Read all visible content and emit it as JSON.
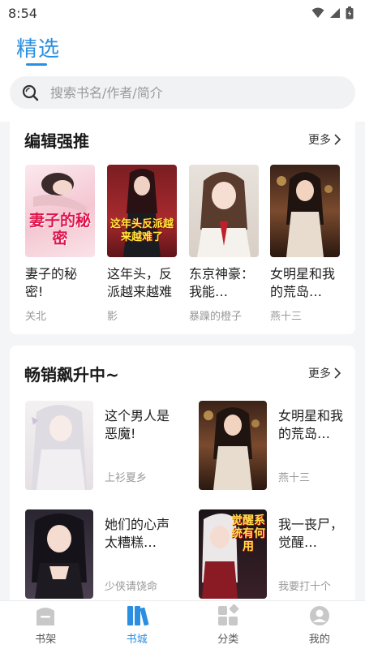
{
  "status": {
    "time": "8:54"
  },
  "header": {
    "title": "精选"
  },
  "search": {
    "placeholder": "搜索书名/作者/简介"
  },
  "sections": [
    {
      "title": "编辑强推",
      "more": "更多",
      "books": [
        {
          "title": "妻子的秘密!",
          "author": "关北",
          "cover_text": "妻子的秘密"
        },
        {
          "title": "这年头，反派越来越难了",
          "author": "影",
          "cover_text": "这年头反派越来越难了"
        },
        {
          "title": "东京神豪：我能…",
          "author": "暴躁的橙子",
          "cover_text": ""
        },
        {
          "title": "女明星和我的荒岛…",
          "author": "燕十三",
          "cover_text": ""
        }
      ]
    },
    {
      "title": "畅销飙升中~",
      "more": "更多",
      "books": [
        {
          "title": "这个男人是恶魔!",
          "author": "上衫夏乡",
          "cover_text": ""
        },
        {
          "title": "女明星和我的荒岛…",
          "author": "燕十三",
          "cover_text": ""
        },
        {
          "title": "她们的心声太糟糕…",
          "author": "少侠请饶命",
          "cover_text": ""
        },
        {
          "title": "我一丧尸，觉醒…",
          "author": "我要打十个",
          "cover_text": "觉醒系统有何用"
        }
      ]
    }
  ],
  "nav": [
    {
      "label": "书架",
      "icon": "bookshelf-icon"
    },
    {
      "label": "书城",
      "icon": "bookstore-icon"
    },
    {
      "label": "分类",
      "icon": "category-icon"
    },
    {
      "label": "我的",
      "icon": "profile-icon"
    }
  ],
  "colors": {
    "accent": "#2a8fe0",
    "nav_inactive": "#c8c8c8"
  }
}
